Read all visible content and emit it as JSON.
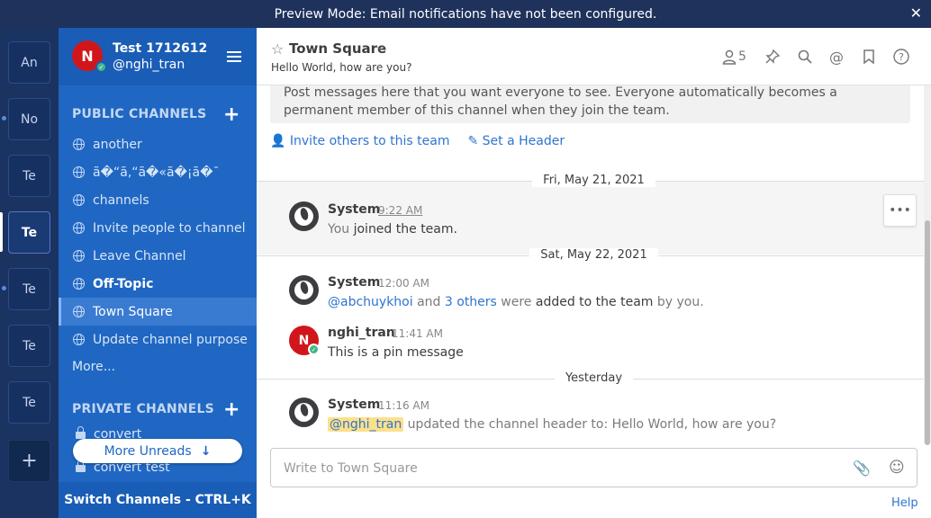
{
  "banner": {
    "text": "Preview Mode: Email notifications have not been configured.",
    "close": "✕"
  },
  "teams": [
    {
      "initials": "An",
      "unread": false,
      "active": false
    },
    {
      "initials": "No",
      "unread": true,
      "active": false
    },
    {
      "initials": "Te",
      "unread": false,
      "active": false
    },
    {
      "initials": "Te",
      "unread": false,
      "active": true
    },
    {
      "initials": "Te",
      "unread": true,
      "active": false
    },
    {
      "initials": "Te",
      "unread": false,
      "active": false
    },
    {
      "initials": "Te",
      "unread": false,
      "active": false
    }
  ],
  "team_add": "+",
  "sidebar": {
    "team_name": "Test 1712612",
    "username": "@nghi_tran",
    "avatar_initial": "N",
    "public_title": "PUBLIC CHANNELS",
    "public_channels": [
      {
        "name": "another",
        "unread": false,
        "active": false
      },
      {
        "name": "ã�“ã‚“ã�«ã�¡ã�¯",
        "unread": false,
        "active": false
      },
      {
        "name": "channels",
        "unread": false,
        "active": false
      },
      {
        "name": "Invite people to channel",
        "unread": false,
        "active": false
      },
      {
        "name": "Leave Channel",
        "unread": false,
        "active": false
      },
      {
        "name": "Off-Topic",
        "unread": true,
        "active": false
      },
      {
        "name": "Town Square",
        "unread": false,
        "active": true
      },
      {
        "name": "Update channel purpose",
        "unread": false,
        "active": false
      }
    ],
    "more": "More...",
    "private_title": "PRIVATE CHANNELS",
    "private_channels": [
      {
        "name": "convert"
      },
      {
        "name": "convert test"
      }
    ],
    "more_unreads": "More Unreads",
    "switch_channels": "Switch Channels - CTRL+K"
  },
  "channel": {
    "title": "Town Square",
    "purpose": "Hello World, how are you?",
    "member_count": "5"
  },
  "intro": {
    "text": "Post messages here that you want everyone to see. Everyone automatically becomes a permanent member of this channel when they join the team.",
    "invite_link": "Invite others to this team",
    "header_link": "Set a Header"
  },
  "posts": {
    "date1": "Fri, May 21, 2021",
    "p1_author": "System",
    "p1_time": "9:22 AM",
    "p1_msg_a": "You ",
    "p1_msg_b": "joined the team.",
    "date2": "Sat, May 22, 2021",
    "p2_author": "System",
    "p2_time": "12:00 AM",
    "p2_mention": "@abchuykhoi",
    "p2_and": " and ",
    "p2_others": "3 others",
    "p2_were": " were ",
    "p2_added": "added to the team",
    "p2_byyou": " by you.",
    "p3_author": "nghi_tran",
    "p3_avatar": "N",
    "p3_time": "11:41 AM",
    "p3_msg": "This is a pin message",
    "date3": "Yesterday",
    "p4_author": "System",
    "p4_time": "11:16 AM",
    "p4_mention": "@nghi_tran",
    "p4_msg": " updated the channel header to: Hello World, how are you?"
  },
  "input": {
    "placeholder": "Write to Town Square"
  },
  "help": "Help"
}
